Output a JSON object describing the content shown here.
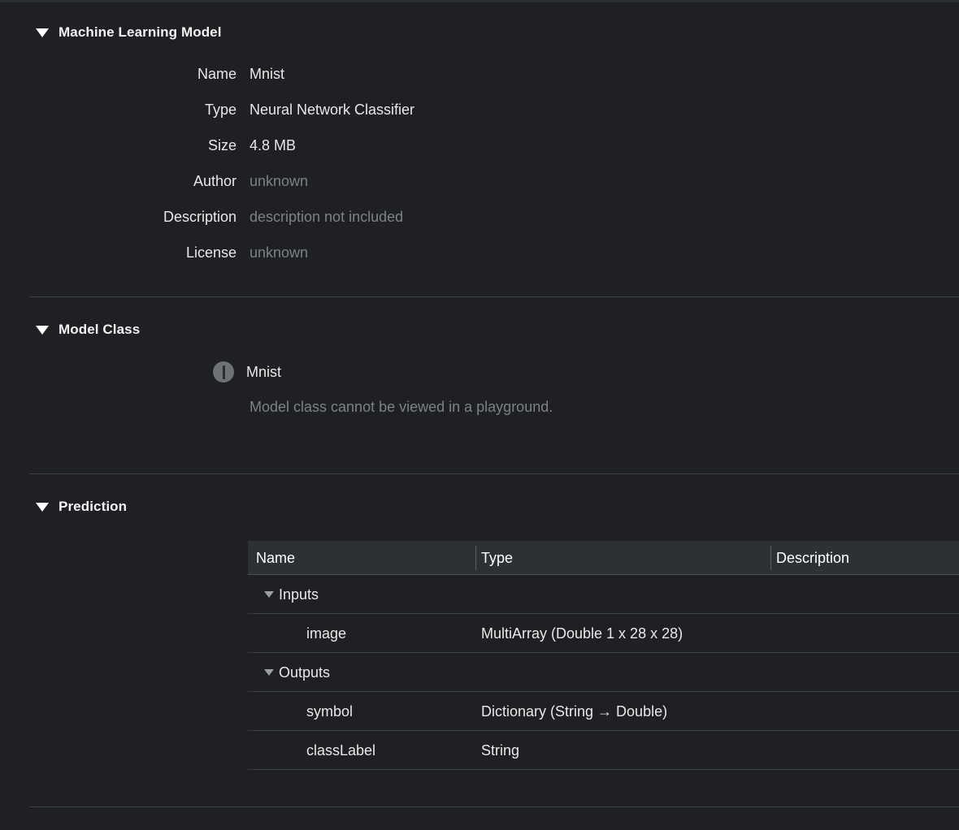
{
  "sections": {
    "ml_model": {
      "title": "Machine Learning Model",
      "rows": [
        {
          "label": "Name",
          "value": "Mnist",
          "muted": false
        },
        {
          "label": "Type",
          "value": "Neural Network Classifier",
          "muted": false
        },
        {
          "label": "Size",
          "value": "4.8 MB",
          "muted": false
        },
        {
          "label": "Author",
          "value": "unknown",
          "muted": true
        },
        {
          "label": "Description",
          "value": "description not included",
          "muted": true
        },
        {
          "label": "License",
          "value": "unknown",
          "muted": true
        }
      ]
    },
    "model_class": {
      "title": "Model Class",
      "class_name": "Mnist",
      "note": "Model class cannot be viewed in a playground.",
      "icon": "warning-exclamation-circle-icon"
    },
    "prediction": {
      "title": "Prediction",
      "table": {
        "columns": [
          "Name",
          "Type",
          "Description"
        ],
        "rows": [
          {
            "kind": "group",
            "name": "Inputs",
            "type": "",
            "description": ""
          },
          {
            "kind": "leaf",
            "name": "image",
            "type": "MultiArray (Double 1 x 28 x 28)",
            "description": ""
          },
          {
            "kind": "group",
            "name": "Outputs",
            "type": "",
            "description": ""
          },
          {
            "kind": "leaf",
            "name": "symbol",
            "type": "Dictionary (String → Double)",
            "description": ""
          },
          {
            "kind": "leaf",
            "name": "classLabel",
            "type": "String",
            "description": ""
          }
        ]
      }
    }
  },
  "icons": {
    "disclosure_open": "triangle-down-icon"
  },
  "colors": {
    "background": "#1e2023",
    "header_background": "#2d3135",
    "text": "#e8e8e8",
    "muted_text": "#7e8184",
    "divider": "#3a3e42"
  }
}
